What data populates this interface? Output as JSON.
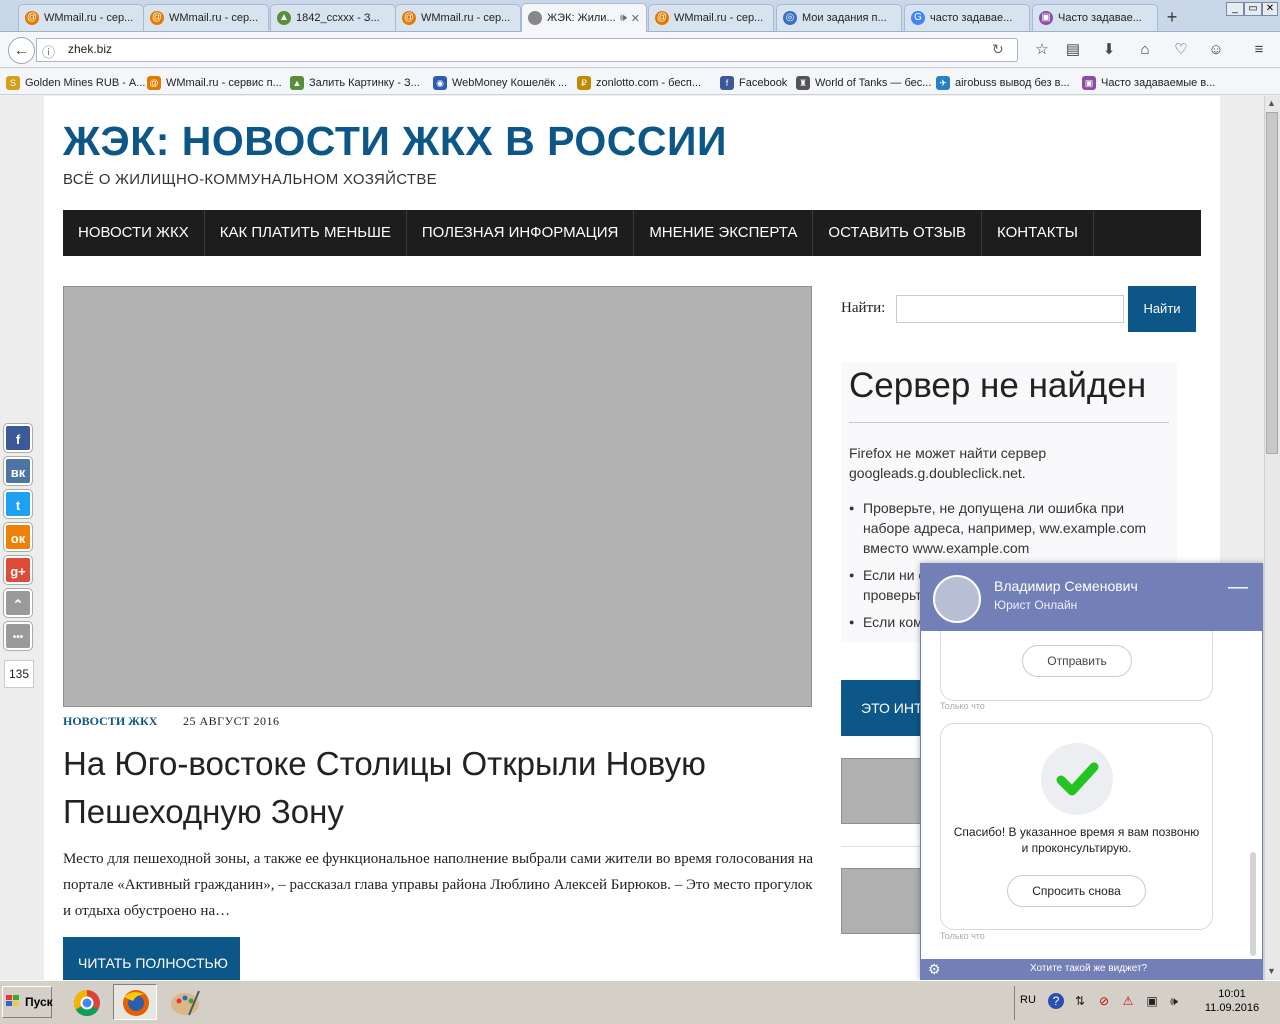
{
  "browser": {
    "tabs": [
      {
        "title": "WMmail.ru - сер...",
        "icon": "wmmail-icon",
        "color": "#e07b00",
        "glyph": "@"
      },
      {
        "title": "WMmail.ru - сер...",
        "icon": "wmmail-icon",
        "color": "#e07b00",
        "glyph": "@"
      },
      {
        "title": "1842_ccxxx - З...",
        "icon": "image-host-icon",
        "color": "#5a8d3a",
        "glyph": "▲"
      },
      {
        "title": "WMmail.ru - сер...",
        "icon": "wmmail-icon",
        "color": "#e07b00",
        "glyph": "@"
      },
      {
        "title": "ЖЭК: Жили...",
        "icon": "page-icon",
        "color": "#888888",
        "glyph": "",
        "active": true
      },
      {
        "title": "WMmail.ru - сер...",
        "icon": "wmmail-icon",
        "color": "#e07b00",
        "glyph": "@"
      },
      {
        "title": "Мои задания п...",
        "icon": "tasks-icon",
        "color": "#3b6fc0",
        "glyph": "◎"
      },
      {
        "title": "часто задавае...",
        "icon": "google-icon",
        "color": "#4285f4",
        "glyph": "G"
      },
      {
        "title": "Часто задавае...",
        "icon": "faq-icon",
        "color": "#8a4fa0",
        "glyph": "▣"
      }
    ],
    "url": "zhek.biz",
    "bookmarks": [
      {
        "label": "Golden Mines RUB - А...",
        "icon": "golden-mines-icon",
        "color": "#d4a017",
        "glyph": "S"
      },
      {
        "label": "WMmail.ru - сервис п...",
        "icon": "wmmail-icon",
        "color": "#e07b00",
        "glyph": "@"
      },
      {
        "label": "Залить Картинку - З...",
        "icon": "image-host-icon",
        "color": "#5a8d3a",
        "glyph": "▲"
      },
      {
        "label": "WebMoney Кошелёк ...",
        "icon": "webmoney-icon",
        "color": "#2a5db0",
        "glyph": "◉"
      },
      {
        "label": "zonlotto.com - бесп...",
        "icon": "zonlotto-icon",
        "color": "#c08a00",
        "glyph": "₽"
      },
      {
        "label": "Facebook",
        "icon": "facebook-icon",
        "color": "#3b5998",
        "glyph": "f"
      },
      {
        "label": "World of Tanks — бес...",
        "icon": "wot-icon",
        "color": "#555555",
        "glyph": "♜"
      },
      {
        "label": "airobuss вывод без в...",
        "icon": "airobuss-icon",
        "color": "#2a7fc0",
        "glyph": "✈"
      },
      {
        "label": "Часто задаваемые в...",
        "icon": "faq-icon",
        "color": "#8a4fa0",
        "glyph": "▣"
      }
    ]
  },
  "site": {
    "title": "ЖЭК: НОВОСТИ ЖКХ В РОССИИ",
    "subtitle": "ВСЁ О ЖИЛИЩНО-КОММУНАЛЬНОМ ХОЗЯЙСТВЕ",
    "menu": [
      "НОВОСТИ ЖКХ",
      "КАК ПЛАТИТЬ МЕНЬШЕ",
      "ПОЛЕЗНАЯ ИНФОРМАЦИЯ",
      "МНЕНИЕ ЭКСПЕРТА",
      "ОСТАВИТЬ ОТЗЫВ",
      "КОНТАКТЫ"
    ]
  },
  "post": {
    "category": "НОВОСТИ ЖКХ",
    "date": "25 АВГУСТ 2016",
    "title": "На Юго-востоке Столицы Открыли Новую Пешеходную Зону",
    "excerpt": "Место для пешеходной зоны, а также ее функциональное наполнение выбрали сами жители во время голосования на портале «Активный гражданин», – рассказал глава управы района Люблино Алексей Бирюков. – Это место прогулок и отдыха обустроено на…",
    "read_more": "ЧИТАТЬ ПОЛНОСТЬЮ"
  },
  "sidebar": {
    "search_label": "Найти:",
    "search_button": "Найти",
    "error": {
      "title": "Сервер не найден",
      "text": "Firefox не может найти сервер googleads.g.doubleclick.net.",
      "items": [
        "Проверьте, не допущена ли ошибка при наборе адреса, например, ww.example.com вместо www.example.com",
        "Если ни одна страница не загружается, проверьте подключение к Интернету.",
        "Если ком"
      ]
    },
    "banner_text": "ЭТО ИНТ"
  },
  "social": {
    "buttons": [
      {
        "name": "facebook-share",
        "glyph": "f",
        "color": "#3b5998"
      },
      {
        "name": "vk-share",
        "glyph": "вк",
        "color": "#4c75a3"
      },
      {
        "name": "twitter-share",
        "glyph": "t",
        "color": "#1da1f2"
      },
      {
        "name": "odnoklassniki-share",
        "glyph": "ок",
        "color": "#ee8208"
      },
      {
        "name": "googleplus-share",
        "glyph": "g+",
        "color": "#dd4b39"
      },
      {
        "name": "scroll-up",
        "glyph": "⌃",
        "color": "#9a9a9a"
      },
      {
        "name": "more-share",
        "glyph": "•••",
        "color": "#9a9a9a"
      }
    ],
    "count": "135"
  },
  "chat": {
    "agent_name": "Владимир Семенович",
    "agent_role": "Юрист Онлайн",
    "send_button": "Отправить",
    "timestamp": "Только что",
    "thanks_message": "Спасибо! В указанное время я вам позвоню и проконсультирую.",
    "ask_again": "Спросить снова",
    "footer_link": "Хотите такой же виджет?"
  },
  "taskbar": {
    "start_label": "Пуск",
    "language": "RU",
    "time": "10:01",
    "date": "11.09.2016"
  },
  "colors": {
    "brand_blue": "#0d5788",
    "menu_black": "#1d1d1d",
    "chat_purple": "#7380b7",
    "check_green": "#22c422"
  }
}
